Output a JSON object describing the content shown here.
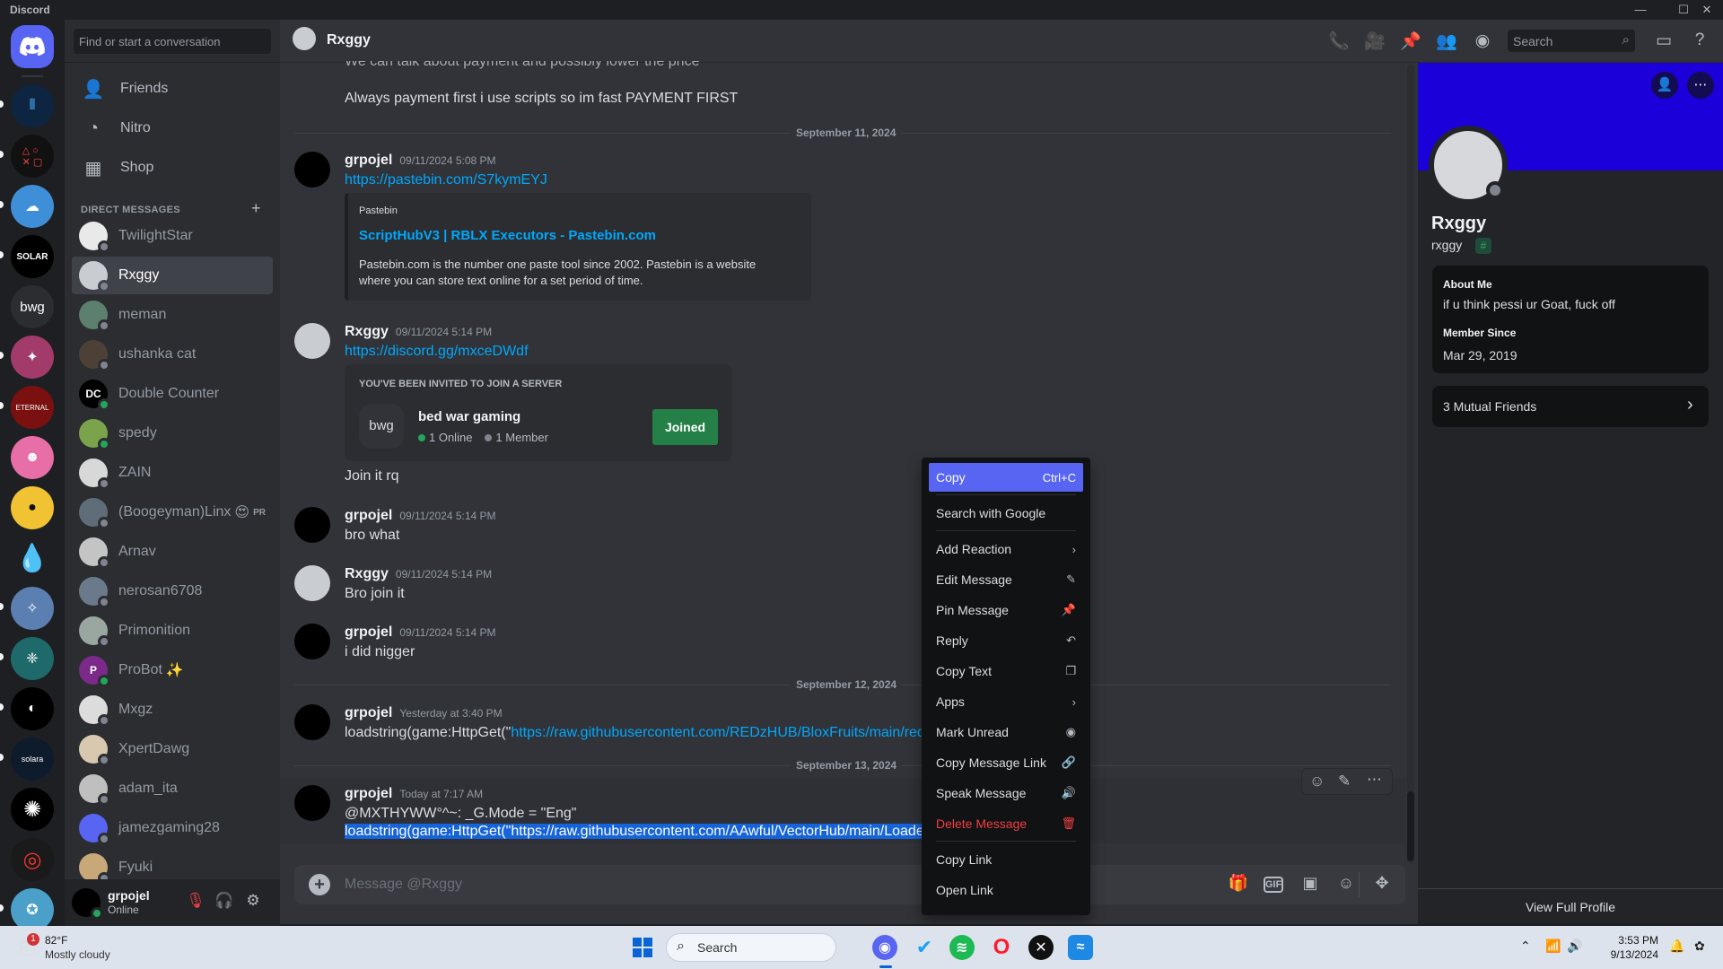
{
  "window": {
    "title": "Discord",
    "controls": {
      "minimize": "—",
      "maximize": "☐",
      "close": "✕"
    }
  },
  "rail": {
    "home_label": "Discord",
    "servers": [
      {
        "label": "bwg"
      }
    ]
  },
  "dm_list": {
    "search_placeholder": "Find or start a conversation",
    "nav": [
      {
        "label": "Friends",
        "icon": "friends-icon"
      },
      {
        "label": "Nitro",
        "icon": "nitro-icon"
      },
      {
        "label": "Shop",
        "icon": "shop-icon"
      }
    ],
    "header": "DIRECT MESSAGES",
    "items": [
      {
        "name": "TwilightStar",
        "status": "offline",
        "color": "#e9e9e9"
      },
      {
        "name": "Rxggy",
        "status": "offline",
        "color": "#c9cdd2",
        "selected": true
      },
      {
        "name": "meman",
        "status": "offline",
        "color": "#5d7f6e"
      },
      {
        "name": "ushanka cat",
        "status": "offline",
        "color": "#4d4137"
      },
      {
        "name": "Double Counter",
        "status": "online",
        "color": "#000000",
        "avatar_text": "DC"
      },
      {
        "name": "spedy",
        "status": "online",
        "color": "#7aa34c"
      },
      {
        "name": "ZAIN",
        "status": "offline",
        "color": "#d8d8d8"
      },
      {
        "name": "(Boogeyman)Linx",
        "status": "offline",
        "color": "#5f6d78",
        "emoji": "😍",
        "tag": "PR"
      },
      {
        "name": "Arnav",
        "status": "offline",
        "color": "#c4c4c4"
      },
      {
        "name": "nerosan6708",
        "status": "offline",
        "color": "#6b7a8a"
      },
      {
        "name": "Primonition",
        "status": "offline",
        "color": "#9aa7a0"
      },
      {
        "name": "ProBot",
        "status": "online",
        "color": "#7b2a8a",
        "emoji": "✨",
        "avatar_text": "P"
      },
      {
        "name": "Mxgz",
        "status": "offline",
        "color": "#dcdcdc"
      },
      {
        "name": "XpertDawg",
        "status": "offline",
        "color": "#d8c8b0"
      },
      {
        "name": "adam_ita",
        "status": "offline",
        "color": "#bfbfbf"
      },
      {
        "name": "jamezgaming28",
        "status": "offline",
        "color": "#5865f2"
      },
      {
        "name": "Fyuki",
        "status": "offline",
        "color": "#c8a878"
      }
    ]
  },
  "user_panel": {
    "name": "grpojel",
    "status": "Online"
  },
  "chat": {
    "header_name": "Rxggy",
    "header_search": "Search",
    "top_partial": "We can talk about payment and possibly lower the price",
    "top_line": "Always payment first i use scripts so im fast PAYMENT FIRST",
    "dates": [
      "September 11, 2024",
      "September 12, 2024",
      "September 13, 2024"
    ],
    "messages": [
      {
        "author": "grpojel",
        "time": "09/11/2024 5:08 PM",
        "link": "https://pastebin.com/S7kymEYJ",
        "embed": {
          "provider": "Pastebin",
          "title": "ScriptHubV3 | RBLX Executors - Pastebin.com",
          "line1": "Pastebin.com is the number one paste tool since 2002. Pastebin is a website",
          "line2": "where you can store text online for a set period of time."
        }
      },
      {
        "author": "Rxggy",
        "time": "09/11/2024 5:14 PM",
        "link": "https://discord.gg/mxceDWdf",
        "invite": {
          "header": "YOU'VE BEEN INVITED TO JOIN A SERVER",
          "icon_text": "bwg",
          "name": "bed war gaming",
          "online": "1 Online",
          "members": "1 Member",
          "button": "Joined"
        },
        "extra": "Join it rq"
      },
      {
        "author": "grpojel",
        "time": "09/11/2024 5:14 PM",
        "text": "bro what"
      },
      {
        "author": "Rxggy",
        "time": "09/11/2024 5:14 PM",
        "text": "Bro join it"
      },
      {
        "author": "grpojel",
        "time": "09/11/2024 5:14 PM",
        "text": "i did nigger"
      },
      {
        "author": "grpojel",
        "time": "Yesterday at 3:40 PM",
        "text_prefix": "loadstring(game:HttpGet(\"",
        "link": "https://raw.githubusercontent.com/REDzHUB/BloxFruits/main/redz"
      },
      {
        "author": "grpojel",
        "time": "Today at 7:17 AM",
        "text": "@MXTHYWW°^~: _G.Mode = \"Eng\"",
        "selected_text": "loadstring(game:HttpGet(\"https://raw.githubusercontent.com/AAwful/VectorHub/main/Loade"
      }
    ],
    "composer_placeholder": "Message @Rxggy"
  },
  "context_menu": {
    "items": [
      {
        "label": "Copy",
        "shortcut": "Ctrl+C",
        "highlighted": true
      },
      {
        "label": "Search with Google"
      },
      {
        "label": "Add Reaction",
        "icon": "›"
      },
      {
        "label": "Edit Message",
        "icon": "✎"
      },
      {
        "label": "Pin Message",
        "icon": "📌"
      },
      {
        "label": "Reply",
        "icon": "↶"
      },
      {
        "label": "Copy Text",
        "icon": "❐"
      },
      {
        "label": "Apps",
        "icon": "›"
      },
      {
        "label": "Mark Unread",
        "icon": "◉"
      },
      {
        "label": "Copy Message Link",
        "icon": "🔗"
      },
      {
        "label": "Speak Message",
        "icon": "🔊"
      },
      {
        "label": "Delete Message",
        "icon": "🗑",
        "danger": true
      },
      {
        "label": "Copy Link"
      },
      {
        "label": "Open Link"
      }
    ]
  },
  "profile": {
    "display_name": "Rxggy",
    "username": "rxggy",
    "badge": "#",
    "about_title": "About Me",
    "about": "if u think pessi ur Goat, fuck off",
    "member_since_title": "Member Since",
    "member_since": "Mar 29, 2019",
    "mutual": "3 Mutual Friends",
    "view_full": "View Full Profile",
    "banner_color": "#1b00d9"
  },
  "taskbar": {
    "weather_temp": "82°F",
    "weather_desc": "Mostly cloudy",
    "weather_badge": "1",
    "search": "Search",
    "time": "3:53 PM",
    "date": "9/13/2024"
  }
}
